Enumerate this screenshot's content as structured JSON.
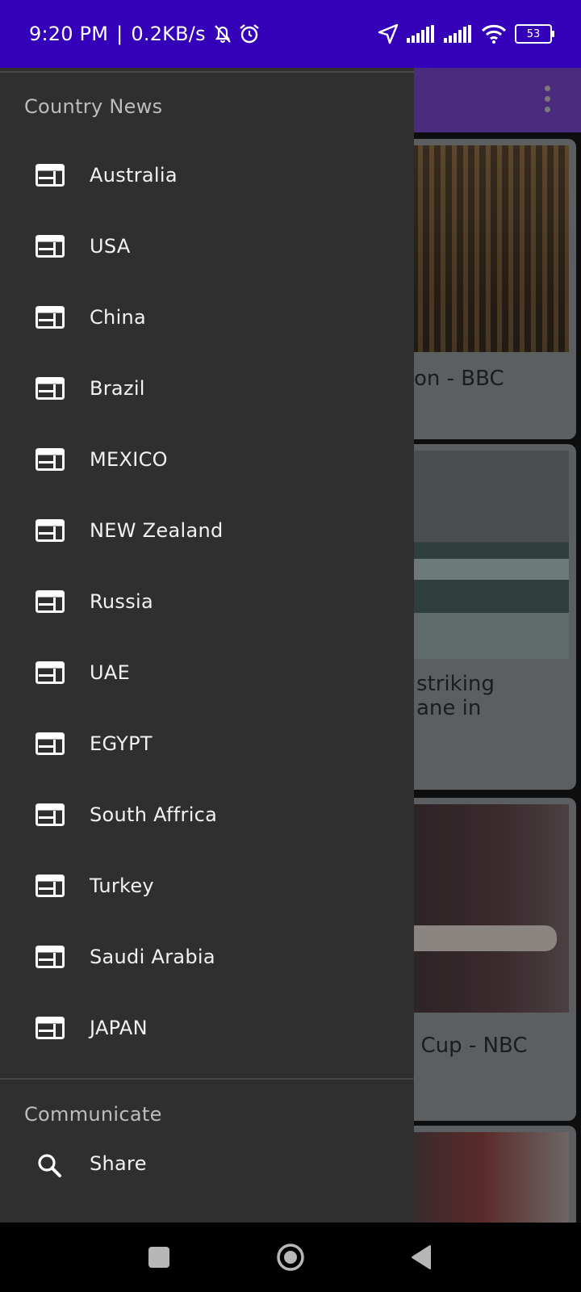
{
  "status_bar": {
    "time": "9:20 PM",
    "separator": "|",
    "speed": "0.2KB/s",
    "battery": "53",
    "icons": [
      "mute-bell-icon",
      "alarm-icon",
      "location-arrow-icon",
      "signal-icon",
      "signal-icon",
      "wifi-icon",
      "battery-icon"
    ]
  },
  "background_app": {
    "card_texts": [
      "on - BBC",
      "striking\nane in",
      "l Cup - NBC"
    ]
  },
  "drawer": {
    "section_country": "Country News",
    "countries": [
      "Australia",
      "USA",
      "China",
      "Brazil",
      "MEXICO",
      "NEW Zealand",
      "Russia",
      "UAE",
      "EGYPT",
      "South Affrica",
      "Turkey",
      "Saudi Arabia",
      "JAPAN"
    ],
    "section_communicate": "Communicate",
    "share_label": "Share"
  },
  "colors": {
    "status_bar": "#3400b8",
    "drawer_bg": "#2f2f2f",
    "toolbar": "#4a2b7e"
  }
}
